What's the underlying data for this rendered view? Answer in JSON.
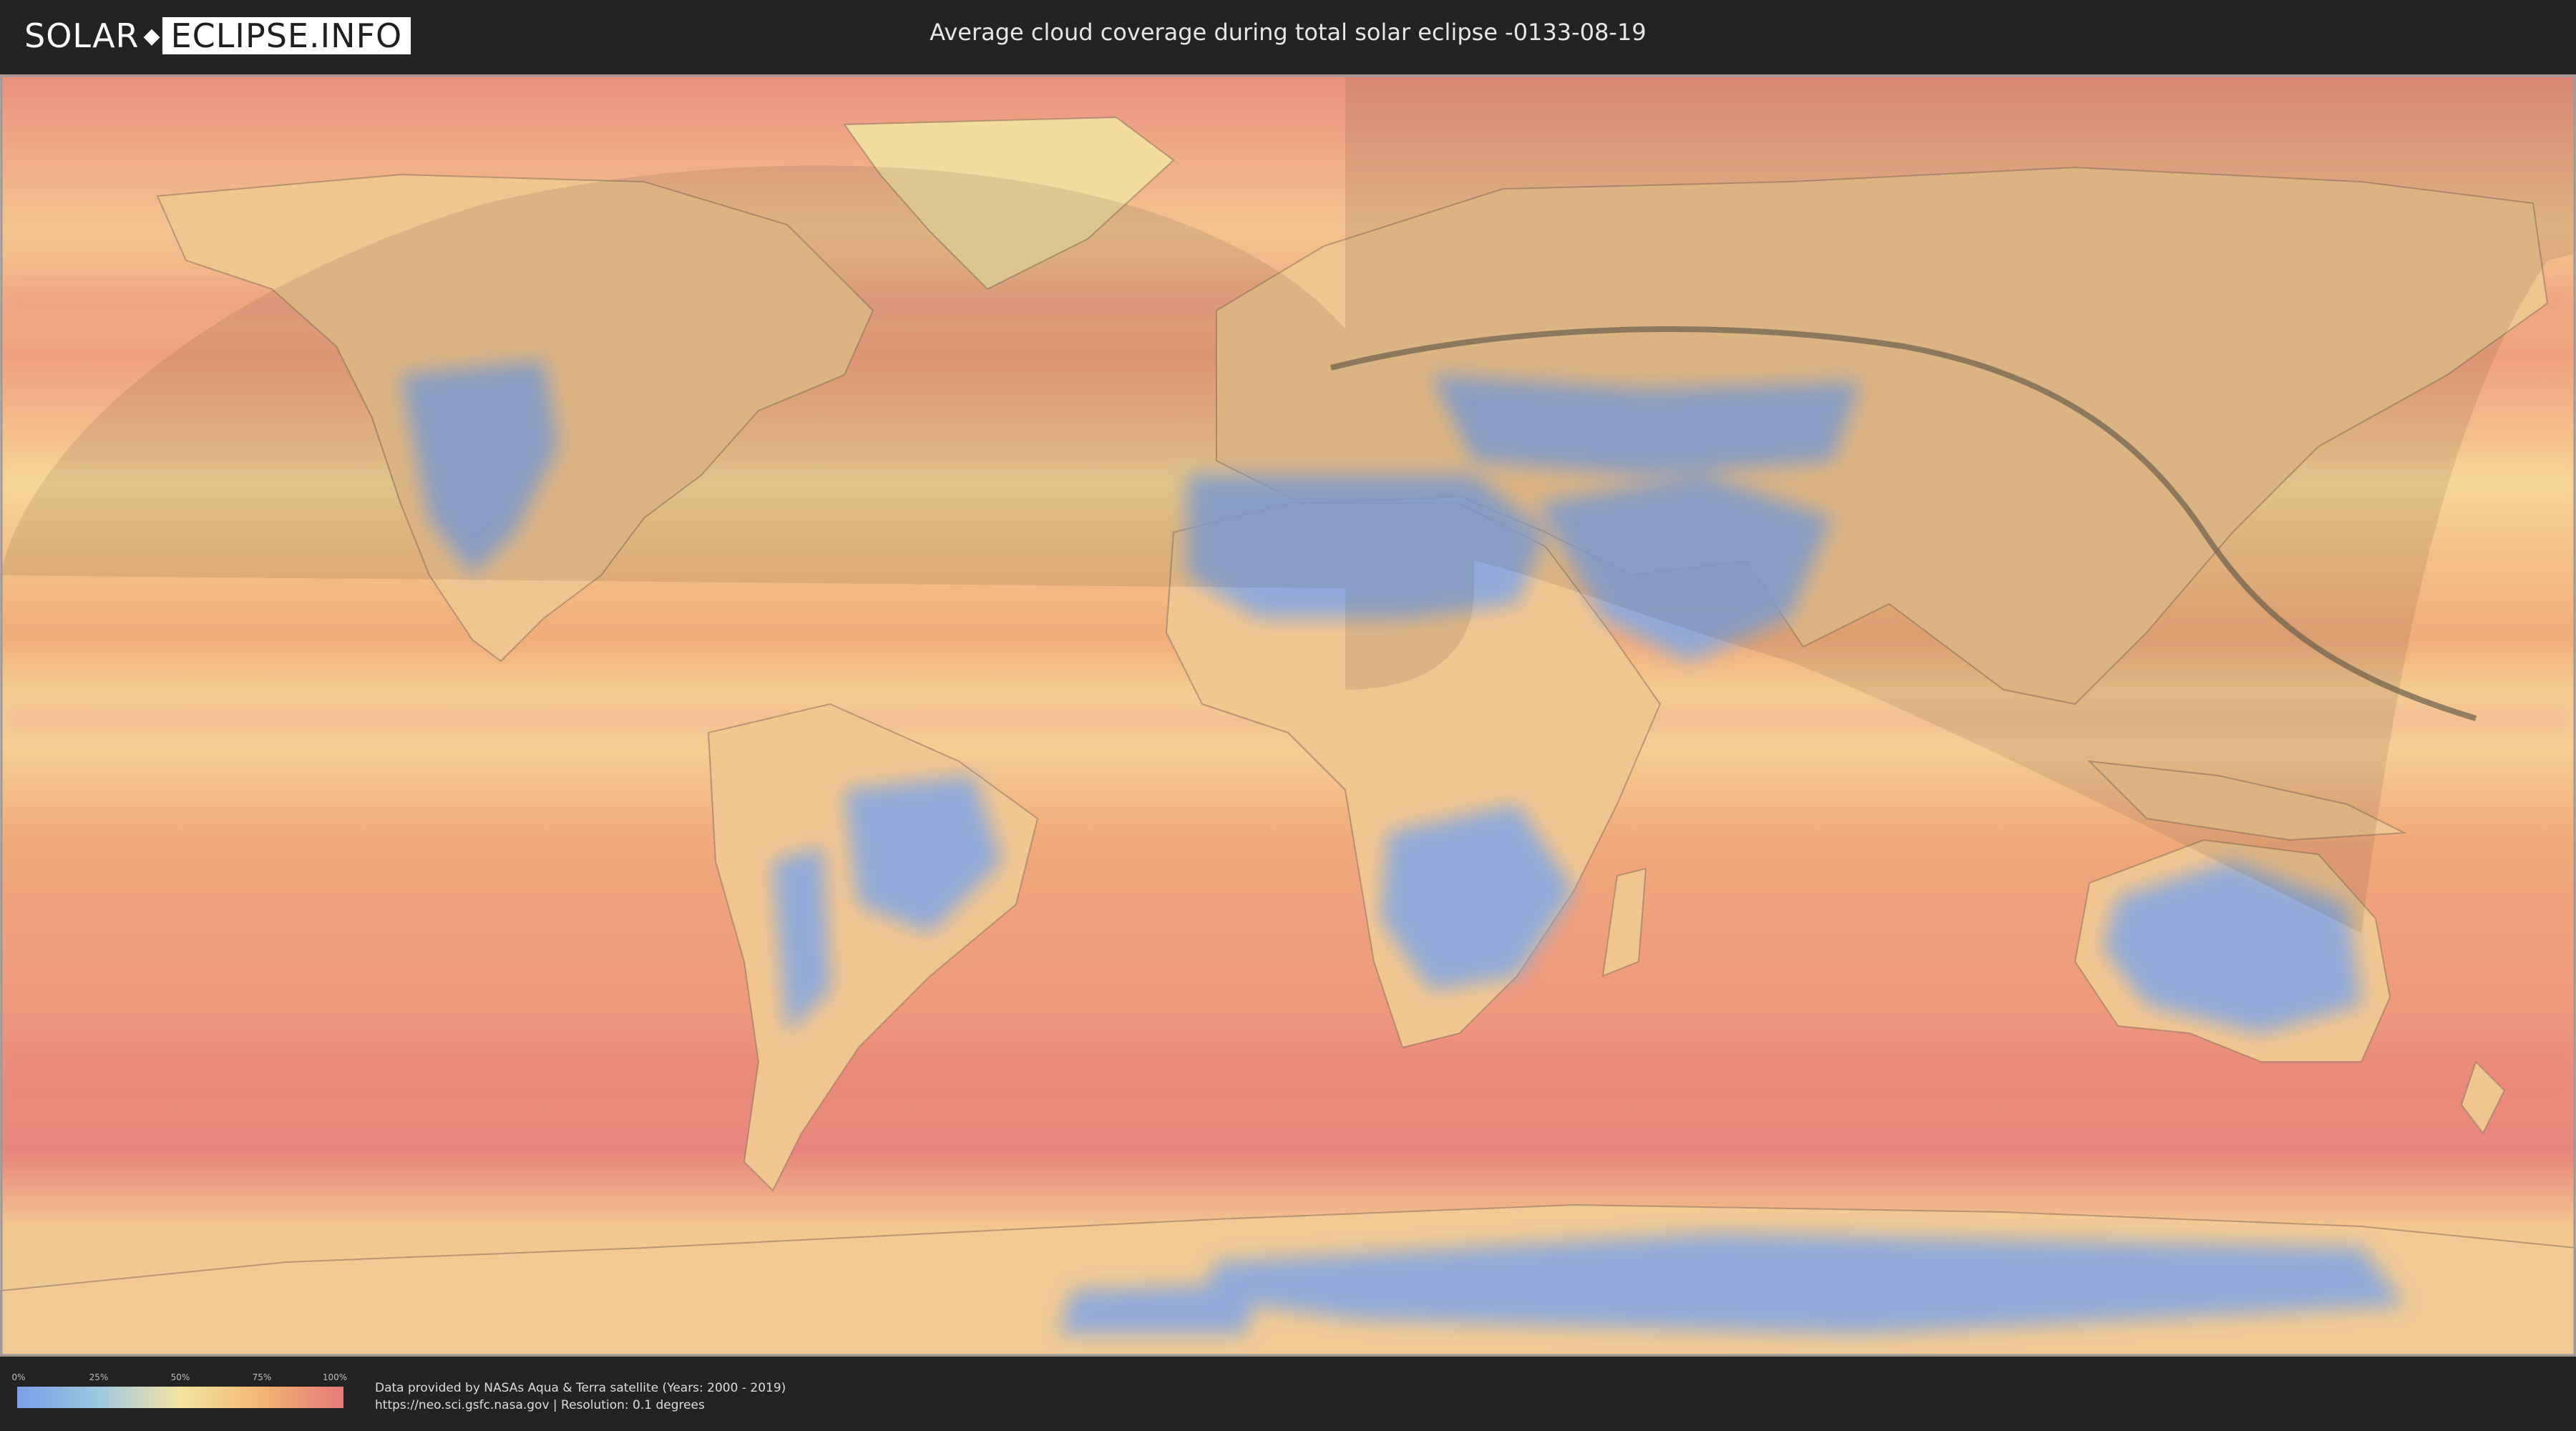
{
  "header": {
    "logo_part1": "SOLAR",
    "logo_part2": "ECLIPSE.INFO",
    "title": "Average cloud coverage during total solar eclipse -0133-08-19"
  },
  "legend": {
    "ticks": [
      "0%",
      "25%",
      "50%",
      "75%",
      "100%"
    ],
    "colors": {
      "low": "#7b9ee6",
      "quarter": "#9cc8e0",
      "mid": "#f4e4a0",
      "three_quarter": "#f2b574",
      "high": "#e67878"
    }
  },
  "credits": {
    "line1": "Data provided by NASAs Aqua & Terra satellite (Years: 2000 - 2019)",
    "line2": "https://neo.sci.gsfc.nasa.gov | Resolution: 0.1 degrees"
  },
  "map": {
    "projection": "equirectangular",
    "layers": [
      "cloud-coverage",
      "country-borders",
      "eclipse-visibility-zone",
      "totality-path"
    ],
    "colors": {
      "ocean_cloud": "#f0a070",
      "land": "#efc588",
      "desert_clear": "#7fa3e0",
      "path": "#6b5e4a",
      "shade": "#5a4a36"
    }
  }
}
